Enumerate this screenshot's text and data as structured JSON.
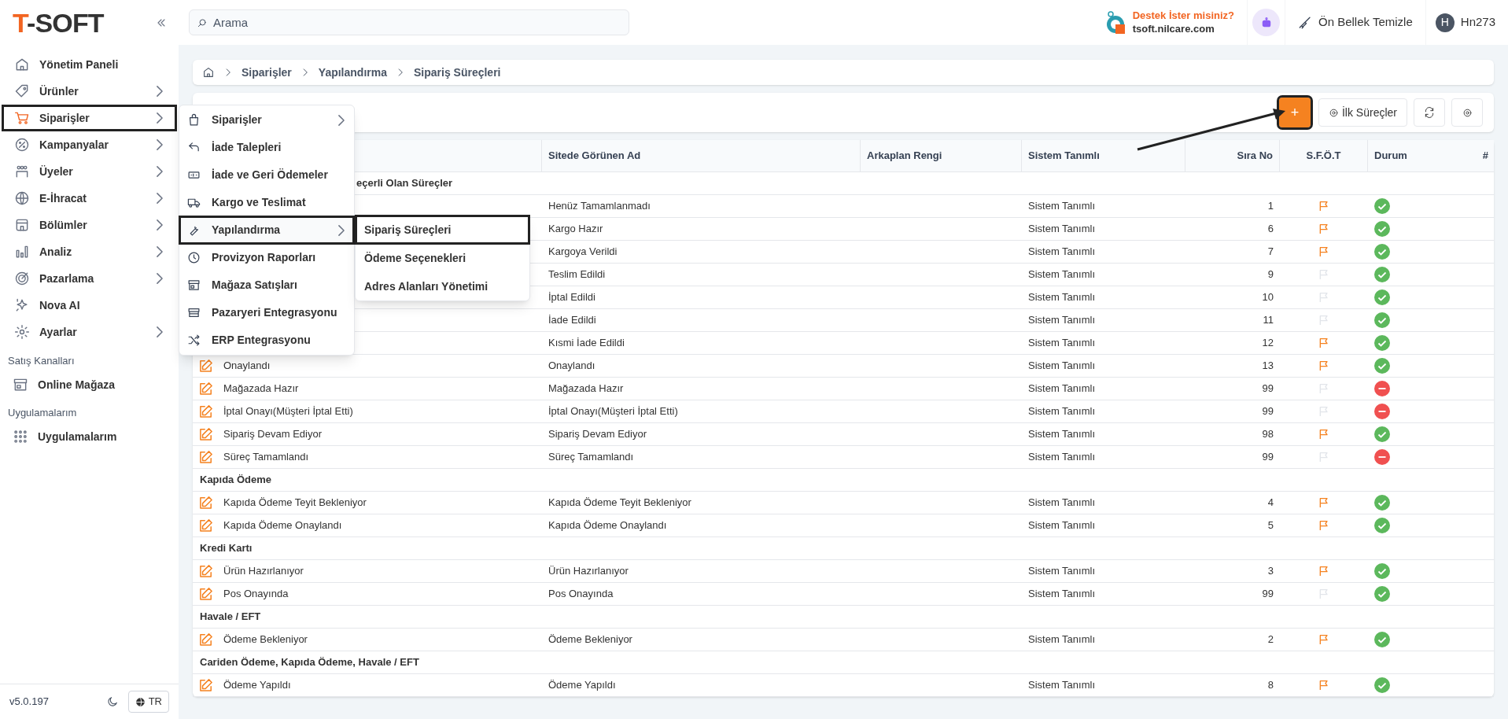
{
  "logo": {
    "first": "T",
    "rest": "-SOFT"
  },
  "search": {
    "placeholder": "Arama"
  },
  "support": {
    "title": "Destek İster misiniz?",
    "site": "tsoft.nilcare.com"
  },
  "cache_button": "Ön Bellek Temizle",
  "user": {
    "initial": "H",
    "name": "Hn273"
  },
  "sidebar": {
    "items": [
      {
        "label": "Yönetim Paneli",
        "has_arrow": false,
        "selected": false,
        "highlighted": false
      },
      {
        "label": "Ürünler",
        "has_arrow": true,
        "selected": false,
        "highlighted": false
      },
      {
        "label": "Siparişler",
        "has_arrow": true,
        "selected": true,
        "highlighted": true
      },
      {
        "label": "Kampanyalar",
        "has_arrow": true,
        "selected": false,
        "highlighted": false
      },
      {
        "label": "Üyeler",
        "has_arrow": true,
        "selected": false,
        "highlighted": false
      },
      {
        "label": "E-İhracat",
        "has_arrow": true,
        "selected": false,
        "highlighted": false
      },
      {
        "label": "Bölümler",
        "has_arrow": true,
        "selected": false,
        "highlighted": false
      },
      {
        "label": "Analiz",
        "has_arrow": true,
        "selected": false,
        "highlighted": false
      },
      {
        "label": "Pazarlama",
        "has_arrow": true,
        "selected": false,
        "highlighted": false
      },
      {
        "label": "Nova AI",
        "has_arrow": false,
        "selected": false,
        "highlighted": false
      },
      {
        "label": "Ayarlar",
        "has_arrow": true,
        "selected": false,
        "highlighted": false
      }
    ],
    "sections": [
      {
        "title": "Satış Kanalları",
        "items": [
          {
            "label": "Online Mağaza"
          }
        ]
      },
      {
        "title": "Uygulamalarım",
        "items": [
          {
            "label": "Uygulamalarım"
          }
        ]
      }
    ],
    "version": "v5.0.197",
    "language": "TR"
  },
  "menu": {
    "items": [
      {
        "label": "Siparişler",
        "has_arrow": true,
        "highlighted": false
      },
      {
        "label": "İade Talepleri",
        "has_arrow": false,
        "highlighted": false
      },
      {
        "label": "İade ve Geri Ödemeler",
        "has_arrow": false,
        "highlighted": false
      },
      {
        "label": "Kargo ve Teslimat",
        "has_arrow": false,
        "highlighted": false
      },
      {
        "label": "Yapılandırma",
        "has_arrow": true,
        "highlighted": true
      },
      {
        "label": "Provizyon Raporları",
        "has_arrow": false,
        "highlighted": false
      },
      {
        "label": "Mağaza Satışları",
        "has_arrow": false,
        "highlighted": false
      },
      {
        "label": "Pazaryeri Entegrasyonu",
        "has_arrow": false,
        "highlighted": false
      },
      {
        "label": "ERP Entegrasyonu",
        "has_arrow": false,
        "highlighted": false
      }
    ],
    "submenu": [
      {
        "label": "Sipariş Süreçleri",
        "highlighted": true
      },
      {
        "label": "Ödeme Seçenekleri",
        "highlighted": false
      },
      {
        "label": "Adres Alanları Yönetimi",
        "highlighted": false
      }
    ]
  },
  "breadcrumb": [
    "Siparişler",
    "Yapılandırma",
    "Sipariş Süreçleri"
  ],
  "toolbar": {
    "add_highlighted": true,
    "add_label": "+",
    "initial_button": "İlk Süreçler"
  },
  "annotation_arrow": true,
  "table": {
    "columns": [
      "Sitede Görünen Ad",
      "Arkaplan Rengi",
      "Sistem Tanımlı",
      "Sıra No",
      "S.F.Ö.T",
      "Durum",
      "#"
    ],
    "groups": [
      {
        "label": "eçerli Olan Süreçler",
        "rows": [
          {
            "site_name": "Henüz Tamamlanmadı",
            "system": "Sistem Tanımlı",
            "order": "1",
            "flag": true,
            "active": true
          },
          {
            "site_name": "Kargo Hazır",
            "system": "Sistem Tanımlı",
            "order": "6",
            "flag": true,
            "active": true
          },
          {
            "site_name": "Kargoya Verildi",
            "system": "Sistem Tanımlı",
            "order": "7",
            "flag": true,
            "active": true
          },
          {
            "site_name": "Teslim Edildi",
            "system": "Sistem Tanımlı",
            "order": "9",
            "flag": false,
            "active": true
          },
          {
            "site_name": "İptal Edildi",
            "system": "Sistem Tanımlı",
            "order": "10",
            "flag": false,
            "active": true
          },
          {
            "site_name": "İade Edildi",
            "system": "Sistem Tanımlı",
            "order": "11",
            "flag": false,
            "active": true
          },
          {
            "site_name": "Kısmi İade Edildi",
            "system": "Sistem Tanımlı",
            "order": "12",
            "flag": true,
            "active": true
          },
          {
            "name": "Onaylandı",
            "site_name": "Onaylandı",
            "system": "Sistem Tanımlı",
            "order": "13",
            "flag": true,
            "active": true
          },
          {
            "name": "Mağazada Hazır",
            "site_name": "Mağazada Hazır",
            "system": "Sistem Tanımlı",
            "order": "99",
            "flag": false,
            "active": false
          },
          {
            "name": "İptal Onayı(Müşteri İptal Etti)",
            "site_name": "İptal Onayı(Müşteri İptal Etti)",
            "system": "Sistem Tanımlı",
            "order": "99",
            "flag": false,
            "active": false
          },
          {
            "name": "Sipariş Devam Ediyor",
            "site_name": "Sipariş Devam Ediyor",
            "system": "Sistem Tanımlı",
            "order": "98",
            "flag": true,
            "active": true
          },
          {
            "name": "Süreç Tamamlandı",
            "site_name": "Süreç Tamamlandı",
            "system": "Sistem Tanımlı",
            "order": "99",
            "flag": false,
            "active": false
          }
        ]
      },
      {
        "label": "Kapıda Ödeme",
        "rows": [
          {
            "name": "Kapıda Ödeme Teyit Bekleniyor",
            "site_name": "Kapıda Ödeme Teyit Bekleniyor",
            "system": "Sistem Tanımlı",
            "order": "4",
            "flag": true,
            "active": true
          },
          {
            "name": "Kapıda Ödeme Onaylandı",
            "site_name": "Kapıda Ödeme Onaylandı",
            "system": "Sistem Tanımlı",
            "order": "5",
            "flag": true,
            "active": true
          }
        ]
      },
      {
        "label": "Kredi Kartı",
        "rows": [
          {
            "name": "Ürün Hazırlanıyor",
            "site_name": "Ürün Hazırlanıyor",
            "system": "Sistem Tanımlı",
            "order": "3",
            "flag": true,
            "active": true
          },
          {
            "name": "Pos Onayında",
            "site_name": "Pos Onayında",
            "system": "Sistem Tanımlı",
            "order": "99",
            "flag": false,
            "active": true
          }
        ]
      },
      {
        "label": "Havale / EFT",
        "rows": [
          {
            "name": "Ödeme Bekleniyor",
            "site_name": "Ödeme Bekleniyor",
            "system": "Sistem Tanımlı",
            "order": "2",
            "flag": true,
            "active": true
          }
        ]
      },
      {
        "label": "Cariden Ödeme, Kapıda Ödeme, Havale / EFT",
        "rows": [
          {
            "name": "Ödeme Yapıldı",
            "site_name": "Ödeme Yapıldı",
            "system": "Sistem Tanımlı",
            "order": "8",
            "flag": true,
            "active": true
          }
        ]
      }
    ]
  }
}
